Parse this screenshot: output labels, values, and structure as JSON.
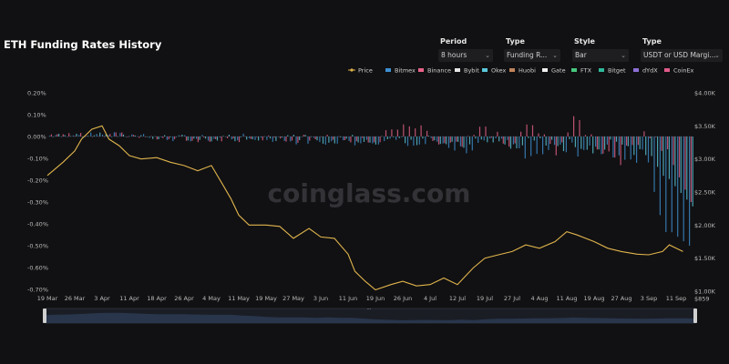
{
  "page": {
    "title": "ETH Funding Rates History"
  },
  "controls": [
    {
      "label": "Period",
      "value": "8 hours"
    },
    {
      "label": "Type",
      "value": "Funding R..."
    },
    {
      "label": "Style",
      "value": "Bar"
    },
    {
      "label": "Type",
      "value": "USDT or USD Margi..."
    }
  ],
  "watermark": "coinglass.com",
  "colors": {
    "background": "#111113",
    "price_line": "#e0b44c",
    "bar_main": "#3d8fd1",
    "bar_alt": "#e8628a",
    "bar_okex": "#5bc7d9",
    "bar_green": "#47c77e"
  },
  "chart_data": {
    "type": "bar",
    "title": "ETH Funding Rates History",
    "legend": [
      {
        "name": "Price",
        "color": "#e0b44c",
        "icon": "line-dot-icon"
      },
      {
        "name": "Bitmex",
        "color": "#3d8fd1",
        "icon": "bar-icon"
      },
      {
        "name": "Binance",
        "color": "#e8628a",
        "icon": "bar-icon"
      },
      {
        "name": "Bybit",
        "color": "#e6e6e6",
        "icon": "bar-icon"
      },
      {
        "name": "Okex",
        "color": "#5bc7d9",
        "icon": "bar-icon"
      },
      {
        "name": "Huobi",
        "color": "#c0845a",
        "icon": "bar-icon"
      },
      {
        "name": "Gate",
        "color": "#f0f0f0",
        "icon": "bar-icon"
      },
      {
        "name": "FTX",
        "color": "#47c77e",
        "icon": "bar-icon"
      },
      {
        "name": "Bitget",
        "color": "#2fb89a",
        "icon": "bar-icon"
      },
      {
        "name": "dYdX",
        "color": "#8c6fd6",
        "icon": "bar-icon"
      },
      {
        "name": "CoinEx",
        "color": "#e05a8a",
        "icon": "bar-icon"
      }
    ],
    "legend_position": "top-right",
    "grid": false,
    "x_ticks": [
      "19 Mar",
      "26 Mar",
      "3 Apr",
      "11 Apr",
      "18 Apr",
      "26 Apr",
      "4 May",
      "11 May",
      "19 May",
      "27 May",
      "3 Jun",
      "11 Jun",
      "19 Jun",
      "26 Jun",
      "4 Jul",
      "12 Jul",
      "19 Jul",
      "27 Jul",
      "4 Aug",
      "11 Aug",
      "19 Aug",
      "27 Aug",
      "3 Sep",
      "11 Sep"
    ],
    "y_left_ticks": [
      "0.20%",
      "0.10%",
      "0.00%",
      "-0.10%",
      "-0.20%",
      "-0.30%",
      "-0.40%",
      "-0.50%",
      "-0.60%",
      "-0.70%"
    ],
    "y_left_range": [
      -0.7,
      0.2
    ],
    "y_right_ticks": [
      "$4.00K",
      "$3.50K",
      "$3.00K",
      "$2.50K",
      "$2.00K",
      "$1.50K",
      "$1.00K",
      "$859"
    ],
    "y_right_range": [
      1000,
      4000
    ],
    "price_series": {
      "name": "Price",
      "dates": [
        "19 Mar",
        "21 Mar",
        "23 Mar",
        "26 Mar",
        "28 Mar",
        "31 Mar",
        "3 Apr",
        "5 Apr",
        "8 Apr",
        "11 Apr",
        "14 Apr",
        "18 Apr",
        "22 Apr",
        "26 Apr",
        "30 Apr",
        "4 May",
        "7 May",
        "9 May",
        "11 May",
        "14 May",
        "19 May",
        "23 May",
        "27 May",
        "31 May",
        "3 Jun",
        "7 Jun",
        "11 Jun",
        "13 Jun",
        "16 Jun",
        "19 Jun",
        "23 Jun",
        "26 Jun",
        "30 Jun",
        "4 Jul",
        "8 Jul",
        "12 Jul",
        "16 Jul",
        "19 Jul",
        "23 Jul",
        "27 Jul",
        "31 Jul",
        "4 Aug",
        "8 Aug",
        "11 Aug",
        "14 Aug",
        "19 Aug",
        "23 Aug",
        "27 Aug",
        "31 Aug",
        "3 Sep",
        "7 Sep",
        "9 Sep",
        "11 Sep",
        "13 Sep"
      ],
      "values": [
        2750,
        2850,
        2950,
        3120,
        3300,
        3450,
        3500,
        3300,
        3200,
        3050,
        3000,
        3020,
        2950,
        2900,
        2820,
        2900,
        2600,
        2400,
        2150,
        2000,
        2000,
        1980,
        1800,
        1950,
        1820,
        1800,
        1560,
        1300,
        1150,
        1020,
        1100,
        1150,
        1080,
        1100,
        1200,
        1100,
        1350,
        1500,
        1550,
        1600,
        1700,
        1650,
        1750,
        1900,
        1850,
        1750,
        1650,
        1600,
        1560,
        1550,
        1600,
        1700,
        1650,
        1600
      ]
    },
    "funding_series": [
      {
        "name": "Bitmex",
        "values": [
          0.004,
          0.006,
          0.01,
          0.012,
          0.008,
          -0.005,
          -0.01,
          -0.008,
          -0.005,
          -0.006,
          -0.012,
          -0.02,
          -0.025,
          -0.03,
          -0.01,
          -0.02,
          -0.04,
          -0.02,
          -0.06,
          -0.04,
          -0.03,
          -0.08,
          -0.05,
          -0.06,
          -0.04,
          -0.12,
          -0.08,
          -0.42,
          -0.5
        ]
      },
      {
        "name": "Binance",
        "values": [
          0.006,
          0.008,
          0.012,
          0.01,
          0.006,
          -0.004,
          -0.008,
          -0.01,
          -0.006,
          -0.01,
          -0.015,
          -0.01,
          0.02,
          -0.02,
          -0.03,
          0.03,
          0.04,
          -0.04,
          -0.05,
          0.05,
          -0.06,
          0.06,
          -0.07,
          0.08,
          -0.05,
          -0.1,
          0.04,
          -0.08,
          -0.3
        ]
      },
      {
        "name": "Okex",
        "values": [
          0.003,
          0.005,
          0.008,
          0.01,
          0.005,
          -0.002,
          -0.006,
          -0.006,
          -0.004,
          -0.008,
          -0.01,
          -0.012,
          -0.015,
          -0.014,
          -0.02,
          -0.018,
          -0.02,
          -0.025,
          -0.03,
          -0.028,
          -0.03,
          -0.035,
          -0.04,
          -0.038,
          -0.05,
          -0.045,
          -0.06,
          -0.2,
          -0.32
        ]
      }
    ]
  }
}
